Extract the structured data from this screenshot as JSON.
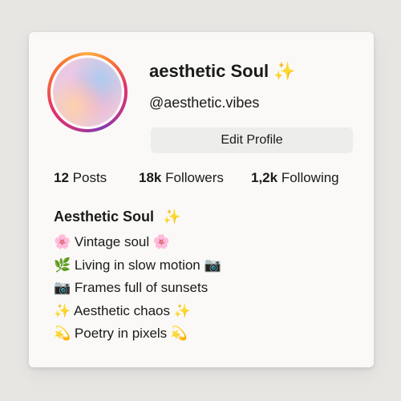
{
  "profile": {
    "username": "aesthetic Soul",
    "username_emoji": "✨",
    "handle": "@aesthetic.vibes",
    "edit_button_label": "Edit Profile"
  },
  "stats": {
    "posts": {
      "count": "12",
      "label": "Posts"
    },
    "followers": {
      "count": "18k",
      "label": "Followers"
    },
    "following": {
      "count": "1,2k",
      "label": "Following"
    }
  },
  "bio": {
    "name": "Aesthetic Soul",
    "name_emoji": "✨",
    "lines": [
      {
        "lead": "🌸",
        "text": "Vintage soul",
        "trail": "🌸"
      },
      {
        "lead": "🌿",
        "text": "Living in slow motion",
        "trail": "📷"
      },
      {
        "lead": "📷",
        "text": "Frames full of sunsets",
        "trail": ""
      },
      {
        "lead": "✨",
        "text": "Aesthetic chaos",
        "trail": "✨"
      },
      {
        "lead": "💫",
        "text": "Poetry in pixels",
        "trail": "💫"
      }
    ]
  },
  "colors": {
    "card_background": "#faf9f7",
    "page_background": "#e8e6e3",
    "button_background": "#ededeb",
    "ring_gradient": [
      "#833ab4",
      "#c13584",
      "#e1306c",
      "#f56040",
      "#fcaf45"
    ]
  }
}
